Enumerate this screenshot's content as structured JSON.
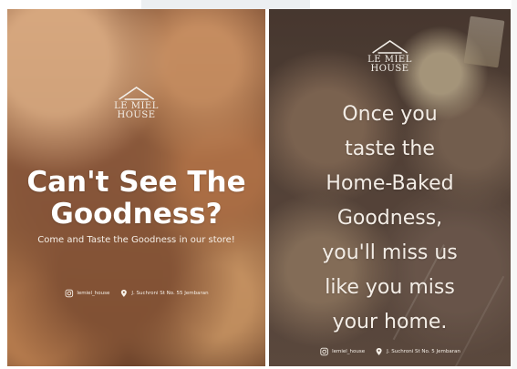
{
  "left_poster": {
    "logo": {
      "line1": "LE MIEL",
      "line2": "HOUSE"
    },
    "headline_line1": "Can't See The",
    "headline_line2": "Goodness?",
    "subline": "Come and Taste the Goodness in our store!",
    "contact_instagram": "lemiel_house",
    "contact_address": "J. Suchroni St No. 55 Jembaran",
    "icons": {
      "instagram": "instagram-icon",
      "location": "location-pin-icon",
      "logo_roof": "house-roof-icon"
    }
  },
  "right_poster": {
    "logo": {
      "line1": "LE MIEL",
      "line2": "HOUSE"
    },
    "quote_lines": [
      "Once you",
      "taste the",
      "Home-Baked",
      "Goodness,",
      "you'll miss us",
      "like you miss",
      "your home."
    ],
    "contact_instagram": "lemiel_house",
    "contact_address": "J. Suchroni St No. 5 Jembaran",
    "icons": {
      "instagram": "instagram-icon",
      "location": "location-pin-icon",
      "logo_roof": "house-roof-icon"
    }
  },
  "colors": {
    "text_light": "#f5efe7",
    "left_bg": "#8d5a38",
    "right_bg": "#5d4c40"
  }
}
